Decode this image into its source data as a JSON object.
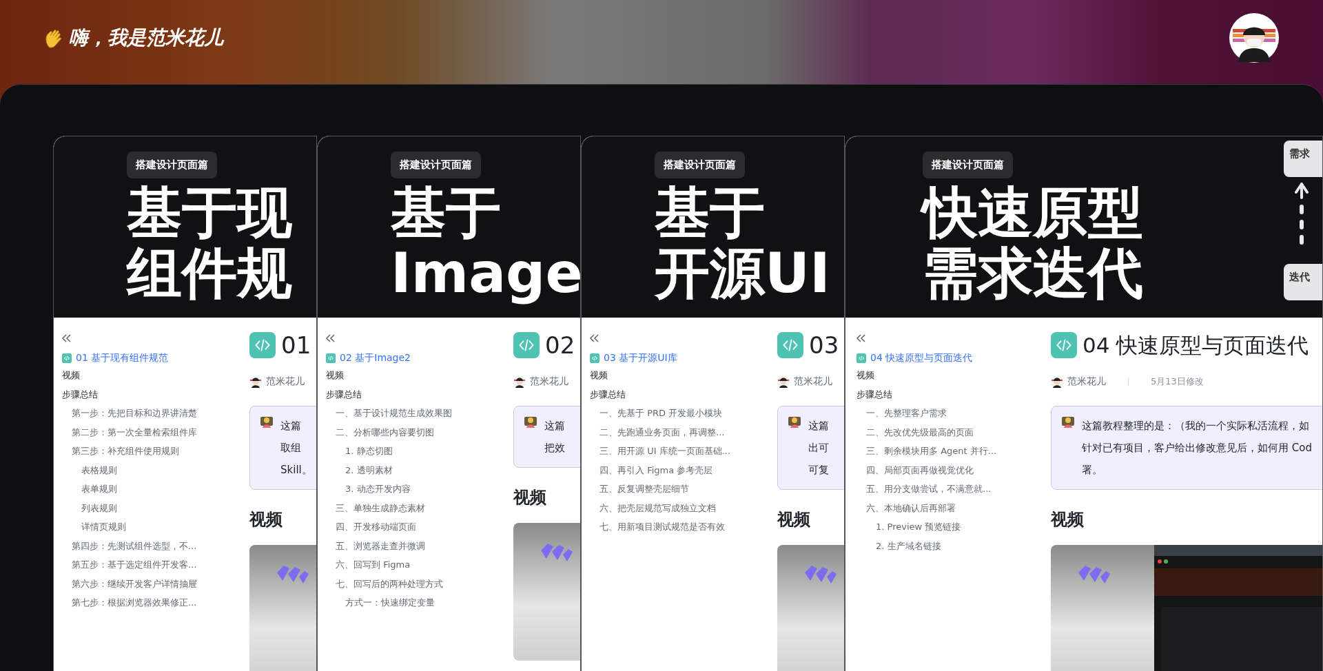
{
  "header": {
    "greeting": "嗨，我是范米花儿"
  },
  "cards": [
    {
      "tag": "搭建设计页面篇",
      "hero_lines": [
        "基于现",
        "组件规"
      ],
      "doc_link": "01 基于现有组件规范",
      "heading": "01",
      "author": "范米花儿",
      "callout_lines": [
        "这篇",
        "取组",
        "Skill。"
      ],
      "video_heading": "视频",
      "outline": [
        {
          "label": "视频"
        },
        {
          "label": "步骤总结",
          "children": [
            {
              "label": "第一步：先把目标和边界讲清楚"
            },
            {
              "label": "第二步：第一次全量检索组件库"
            },
            {
              "label": "第三步：补充组件使用规则",
              "children": [
                {
                  "label": "表格规则"
                },
                {
                  "label": "表单规则"
                },
                {
                  "label": "列表规则"
                },
                {
                  "label": "详情页规则"
                }
              ]
            },
            {
              "label": "第四步：先测试组件选型，不..."
            },
            {
              "label": "第五步：基于选定组件开发客..."
            },
            {
              "label": "第六步：继续开发客户详情抽屉"
            },
            {
              "label": "第七步：根据浏览器效果修正..."
            }
          ]
        }
      ]
    },
    {
      "tag": "搭建设计页面篇",
      "hero_lines": [
        "基于",
        "Image"
      ],
      "doc_link": "02 基于Image2",
      "heading": "02",
      "author": "范米花儿",
      "callout_lines": [
        "这篇",
        "把效"
      ],
      "video_heading": "视频",
      "outline": [
        {
          "label": "视频"
        },
        {
          "label": "步骤总结",
          "children": [
            {
              "label": "一、基于设计规范生成效果图"
            },
            {
              "label": "二、分析哪些内容要切图",
              "children": [
                {
                  "label": "1. 静态切图"
                },
                {
                  "label": "2. 透明素材"
                },
                {
                  "label": "3. 动态开发内容"
                }
              ]
            },
            {
              "label": "三、单独生成静态素材"
            },
            {
              "label": "四、开发移动端页面"
            },
            {
              "label": "五、浏览器走查并微调"
            },
            {
              "label": "六、回写到 Figma"
            },
            {
              "label": "七、回写后的两种处理方式",
              "children": [
                {
                  "label": "方式一：快速绑定变量"
                }
              ]
            }
          ]
        }
      ]
    },
    {
      "tag": "搭建设计页面篇",
      "hero_lines": [
        "基于",
        "开源UI"
      ],
      "doc_link": "03 基于开源UI库",
      "heading": "03",
      "author": "范米花儿",
      "callout_lines": [
        "这篇",
        "出可",
        "可复"
      ],
      "video_heading": "视频",
      "outline": [
        {
          "label": "视频"
        },
        {
          "label": "步骤总结",
          "children": [
            {
              "label": "一、先基于 PRD 开发最小模块"
            },
            {
              "label": "二、先跑通业务页面，再调整..."
            },
            {
              "label": "三、用开源 UI 库统一页面基础..."
            },
            {
              "label": "四、再引入 Figma 参考壳层"
            },
            {
              "label": "五、反复调整壳层细节"
            },
            {
              "label": "六、把壳层规范写成独立文档"
            },
            {
              "label": "七、用新项目测试规范是否有效"
            }
          ]
        }
      ]
    },
    {
      "tag": "搭建设计页面篇",
      "hero_lines": [
        "快速原型",
        "需求迭代"
      ],
      "side_notes": [
        "需求",
        "迭代"
      ],
      "doc_link": "04 快速原型与页面迭代",
      "heading": "04 快速原型与页面迭代",
      "author": "范米花儿",
      "modified": "5月13日修改",
      "callout_lines": [
        "这篇教程整理的是：（我的一个实际私活流程，如",
        "针对已有项目，客户给出修改意见后，如何用 Cod",
        "署。"
      ],
      "video_heading": "视频",
      "outline": [
        {
          "label": "视频"
        },
        {
          "label": "步骤总结",
          "children": [
            {
              "label": "一、先整理客户需求"
            },
            {
              "label": "二、先改优先级最高的页面"
            },
            {
              "label": "三、剩余模块用多 Agent 并行..."
            },
            {
              "label": "四、局部页面再做视觉优化"
            },
            {
              "label": "五、用分支做尝试，不满意就..."
            },
            {
              "label": "六、本地确认后再部署",
              "children": [
                {
                  "label": "1. Preview 预览链接"
                },
                {
                  "label": "2. 生产域名链接"
                }
              ]
            }
          ]
        }
      ]
    }
  ]
}
